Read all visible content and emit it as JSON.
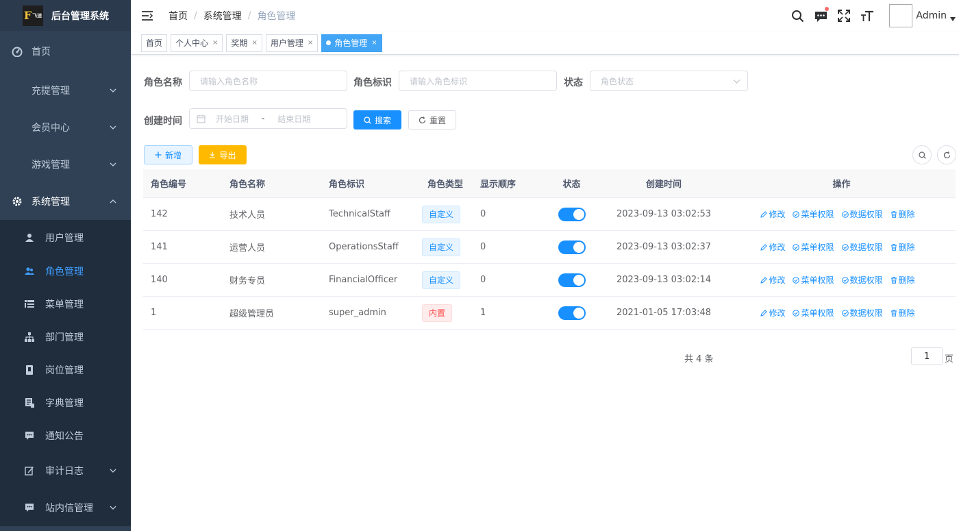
{
  "sidebar": {
    "logo_mark": "F",
    "logo_small": "飞速",
    "title": "后台管理系统",
    "items": [
      {
        "label": "首页"
      },
      {
        "label": "充提管理"
      },
      {
        "label": "会员中心"
      },
      {
        "label": "游戏管理"
      },
      {
        "label": "系统管理"
      }
    ],
    "sub_items": [
      {
        "label": "用户管理"
      },
      {
        "label": "角色管理"
      },
      {
        "label": "菜单管理"
      },
      {
        "label": "部门管理"
      },
      {
        "label": "岗位管理"
      },
      {
        "label": "字典管理"
      },
      {
        "label": "通知公告"
      },
      {
        "label": "审计日志"
      },
      {
        "label": "站内信管理"
      }
    ]
  },
  "header": {
    "breadcrumb": [
      "首页",
      "系统管理",
      "角色管理"
    ],
    "user": "Admin"
  },
  "tags": [
    {
      "label": "首页",
      "closable": false
    },
    {
      "label": "个人中心",
      "closable": true
    },
    {
      "label": "奖期",
      "closable": true
    },
    {
      "label": "用户管理",
      "closable": true
    },
    {
      "label": "角色管理",
      "closable": true,
      "active": true
    }
  ],
  "search": {
    "role_name_label": "角色名称",
    "role_name_placeholder": "请输入角色名称",
    "role_key_label": "角色标识",
    "role_key_placeholder": "请输入角色标识",
    "status_label": "状态",
    "status_placeholder": "角色状态",
    "created_label": "创建时间",
    "start_placeholder": "开始日期",
    "range_sep": "-",
    "end_placeholder": "结束日期",
    "search_btn": "搜索",
    "reset_btn": "重置"
  },
  "toolbar": {
    "add_btn": "新增",
    "export_btn": "导出"
  },
  "table": {
    "columns": [
      "角色编号",
      "角色名称",
      "角色标识",
      "角色类型",
      "显示顺序",
      "状态",
      "创建时间",
      "操作"
    ],
    "rows": [
      {
        "id": "142",
        "name": "技术人员",
        "key": "TechnicalStaff",
        "type": "自定义",
        "type_kind": "custom",
        "sort": "0",
        "enabled": true,
        "created": "2023-09-13 03:02:53"
      },
      {
        "id": "141",
        "name": "运营人员",
        "key": "OperationsStaff",
        "type": "自定义",
        "type_kind": "custom",
        "sort": "0",
        "enabled": true,
        "created": "2023-09-13 03:02:37"
      },
      {
        "id": "140",
        "name": "财务专员",
        "key": "FinancialOfficer",
        "type": "自定义",
        "type_kind": "custom",
        "sort": "0",
        "enabled": true,
        "created": "2023-09-13 03:02:14"
      },
      {
        "id": "1",
        "name": "超级管理员",
        "key": "super_admin",
        "type": "内置",
        "type_kind": "builtin",
        "sort": "1",
        "enabled": true,
        "created": "2021-01-05 17:03:48"
      }
    ],
    "ops": [
      "修改",
      "菜单权限",
      "数据权限",
      "删除"
    ]
  },
  "pagination": {
    "total": "共 4 条",
    "page": "1",
    "unit": "页"
  },
  "colors": {
    "sidebar_bg": "#304156",
    "accent": "#1890ff",
    "warning": "#ffba00",
    "danger": "#ff4949"
  }
}
